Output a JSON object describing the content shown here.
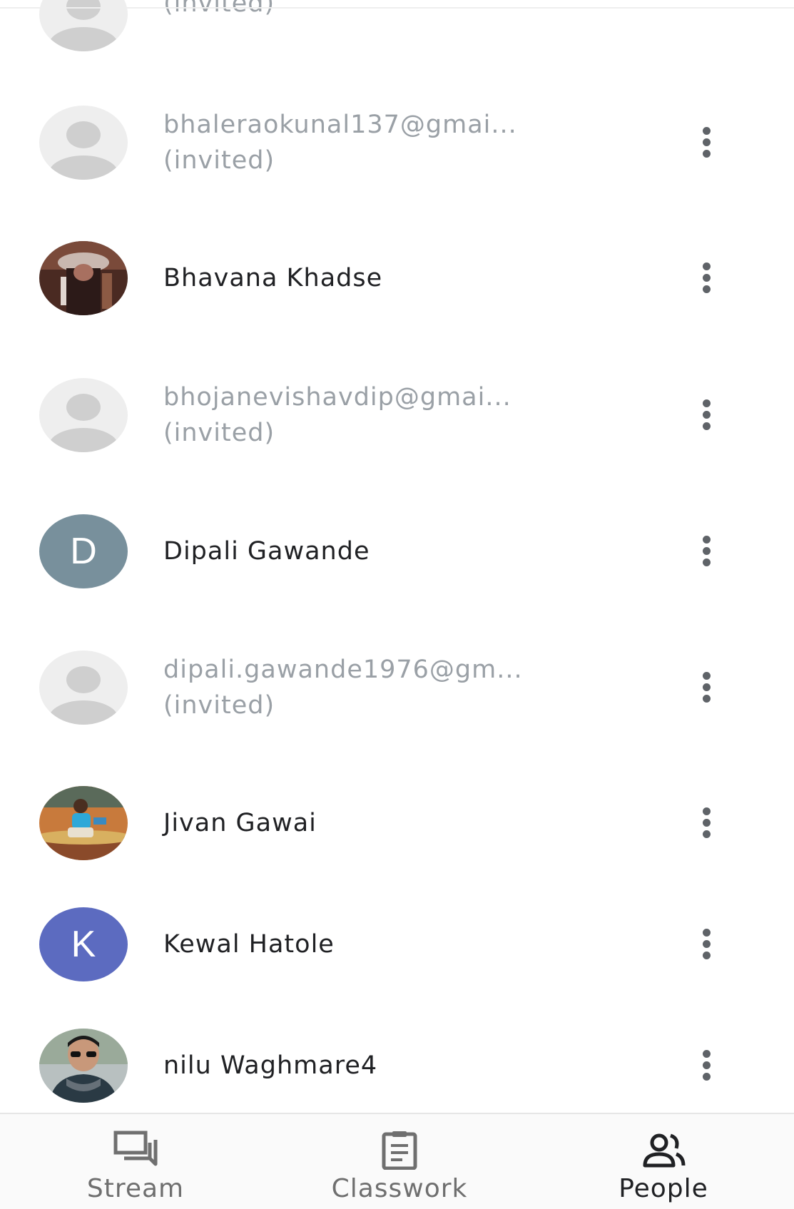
{
  "people": [
    {
      "avatar": "placeholder",
      "status": "(invited)",
      "partial": true
    },
    {
      "avatar": "placeholder",
      "email": "bhaleraokunal137@gmai...",
      "status": "(invited)"
    },
    {
      "avatar": "photo",
      "name": "Bhavana Khadse"
    },
    {
      "avatar": "placeholder",
      "email": "bhojanevishavdip@gmai...",
      "status": "(invited)"
    },
    {
      "avatar": "letter",
      "letter": "D",
      "color": "#78909c",
      "name": "Dipali Gawande"
    },
    {
      "avatar": "placeholder",
      "email": "dipali.gawande1976@gm...",
      "status": "(invited)"
    },
    {
      "avatar": "photo",
      "name": "Jivan Gawai"
    },
    {
      "avatar": "letter",
      "letter": "K",
      "color": "#5c6bc0",
      "name": "Kewal Hatole"
    },
    {
      "avatar": "photo",
      "name": "nilu Waghmare4"
    }
  ],
  "bottom_nav": {
    "stream_label": "Stream",
    "classwork_label": "Classwork",
    "people_label": "People",
    "active_tab": "people"
  },
  "icons": {
    "more": "more-vert-icon",
    "stream": "stream-icon",
    "classwork": "classwork-icon",
    "people": "people-icon"
  }
}
